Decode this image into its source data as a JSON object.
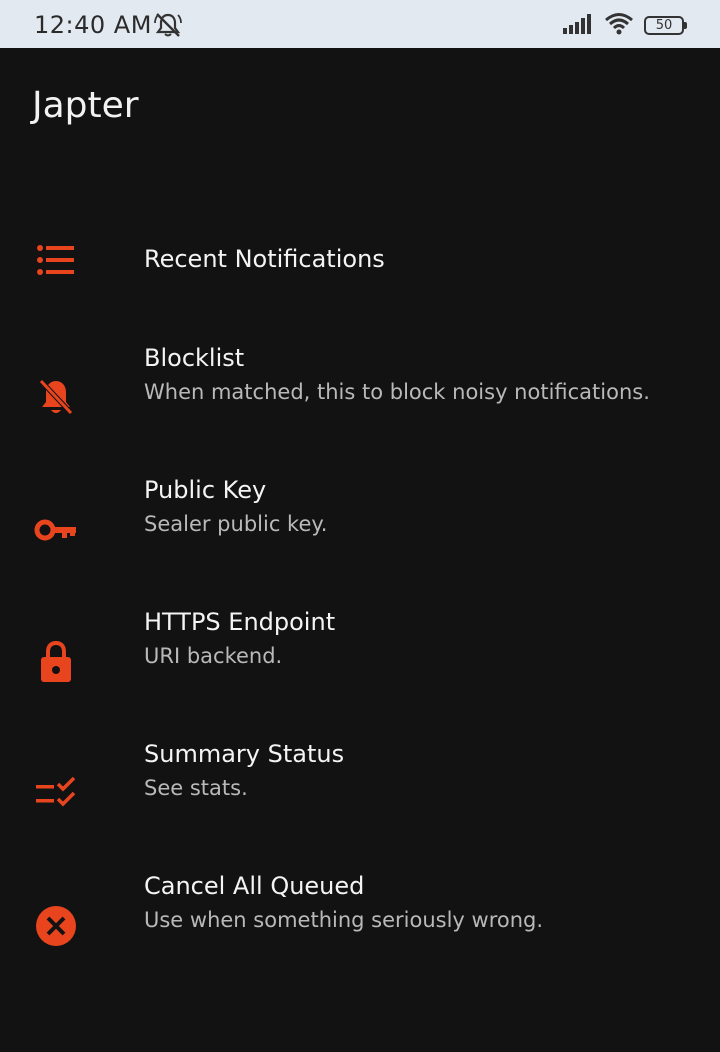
{
  "status_bar": {
    "time": "12:40 AM",
    "battery": "50",
    "dnd_icon": "bell-off-icon",
    "signal_icon": "signal-icon",
    "wifi_icon": "wifi-icon",
    "battery_icon": "battery-icon"
  },
  "app": {
    "title": "Japter",
    "accent_color": "#e8451f"
  },
  "menu": {
    "items": [
      {
        "label": "Recent Notifications",
        "description": "",
        "icon": "list-icon"
      },
      {
        "label": "Blocklist",
        "description": "When matched, this to block noisy notifications.",
        "icon": "bell-off-icon"
      },
      {
        "label": "Public Key",
        "description": "Sealer public key.",
        "icon": "key-icon"
      },
      {
        "label": "HTTPS Endpoint",
        "description": "URI backend.",
        "icon": "lock-icon"
      },
      {
        "label": "Summary Status",
        "description": "See stats.",
        "icon": "checklist-icon"
      },
      {
        "label": "Cancel All Queued",
        "description": "Use when something seriously wrong.",
        "icon": "cancel-circle-icon"
      }
    ]
  }
}
